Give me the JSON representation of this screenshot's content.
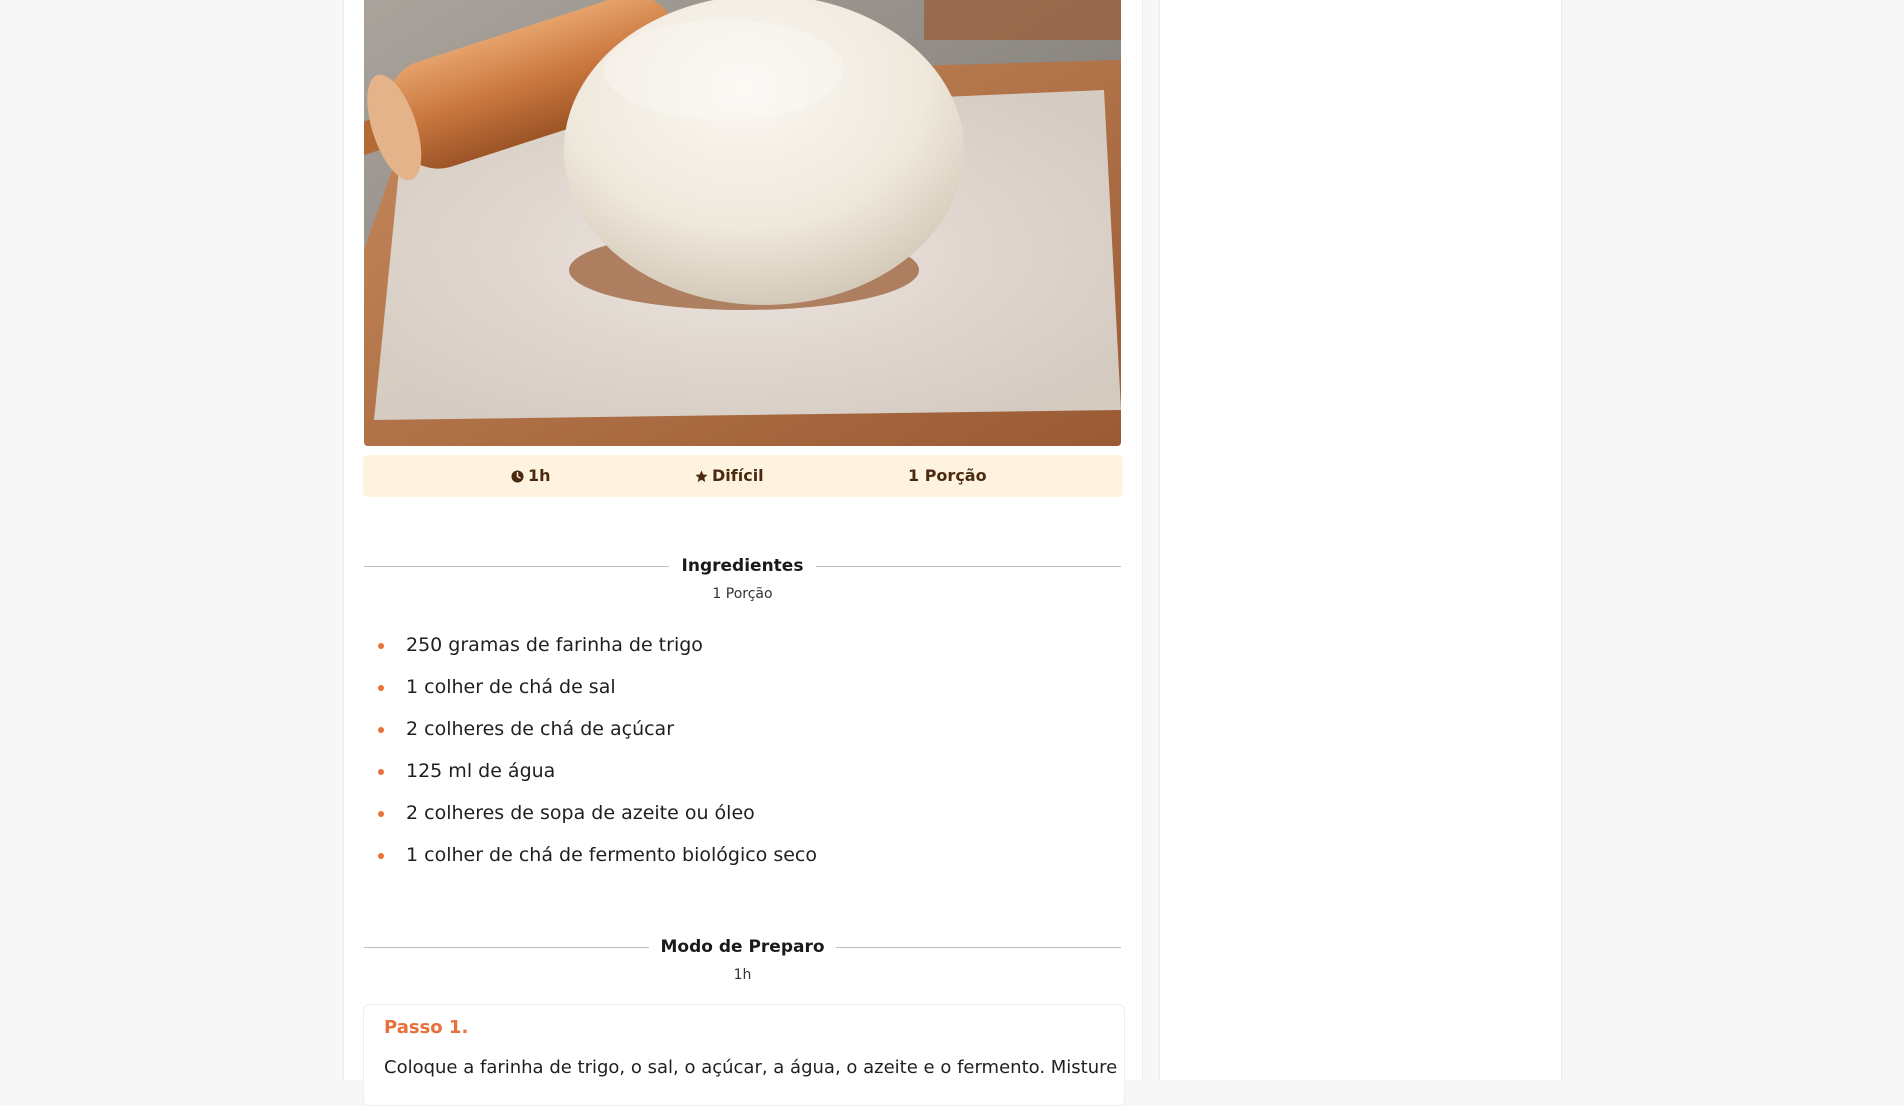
{
  "recipe": {
    "meta": {
      "time": "1h",
      "difficulty": "Difícil",
      "portions": "1 Porção"
    },
    "ingredients_section": {
      "title": "Ingredientes",
      "subtitle": "1 Porção",
      "items": [
        "250 gramas de farinha de trigo",
        "1 colher de chá de sal",
        "2 colheres de chá de açúcar",
        "125 ml de água",
        "2 colheres de sopa de azeite ou óleo",
        "1 colher de chá de fermento biológico seco"
      ]
    },
    "preparation_section": {
      "title": "Modo de Preparo",
      "subtitle": "1h",
      "steps": [
        {
          "title": "Passo 1.",
          "text": "Coloque a farinha de trigo, o sal, o açúcar, a água, o azeite e o fermento. Misture"
        }
      ]
    }
  },
  "icons": {
    "time": "clock-icon",
    "difficulty": "star-icon"
  },
  "colors": {
    "accent": "#e8703a",
    "meta_background": "#fdf3de",
    "meta_text": "#4b2a10",
    "page_background": "#f7f7f7"
  }
}
